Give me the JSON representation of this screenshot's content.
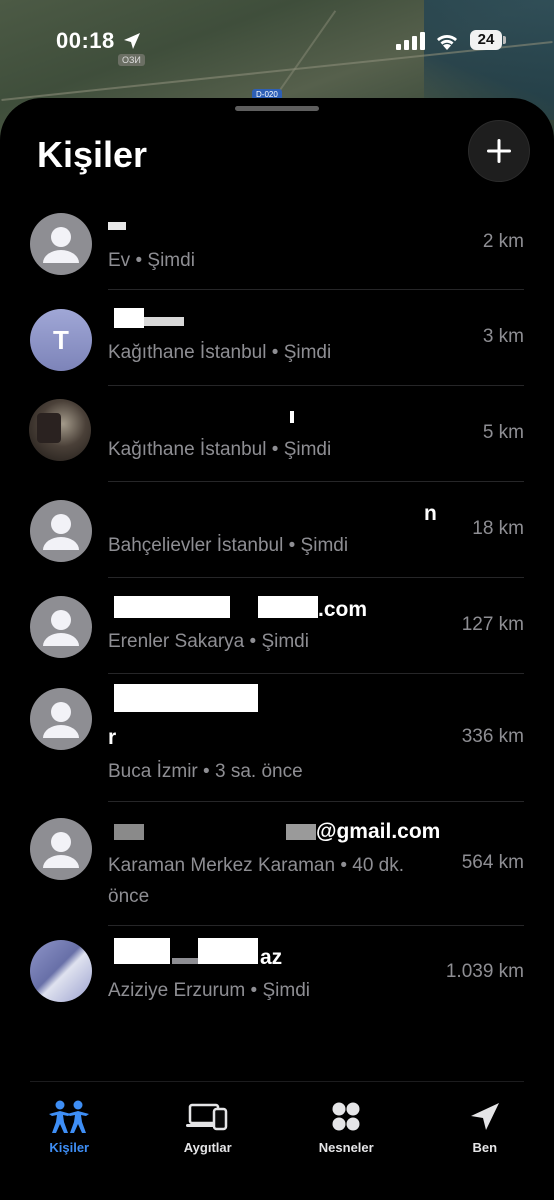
{
  "status_bar": {
    "time": "00:18",
    "battery": "24"
  },
  "map": {
    "labels": [
      "ОЗИ",
      "D-020"
    ]
  },
  "sheet": {
    "title": "Kişiler",
    "add_label": "+"
  },
  "people": [
    {
      "name": "",
      "initial": "",
      "location": "Ev",
      "time": "Şimdi",
      "distance": "2 km",
      "avatar": "generic"
    },
    {
      "name": "",
      "initial": "T",
      "location": "Kağıthane İstanbul",
      "time": "Şimdi",
      "distance": "3 km",
      "avatar": "initial"
    },
    {
      "name": "",
      "initial": "",
      "location": "Kağıthane İstanbul",
      "time": "Şimdi",
      "distance": "5 km",
      "avatar": "photo"
    },
    {
      "name": "n",
      "initial": "",
      "location": "Bahçelievler İstanbul",
      "time": "Şimdi",
      "distance": "18 km",
      "avatar": "generic"
    },
    {
      "name": ".com",
      "initial": "",
      "location": "Erenler Sakarya",
      "time": "Şimdi",
      "distance": "127 km",
      "avatar": "generic"
    },
    {
      "name": "r",
      "initial": "",
      "location": "Buca İzmir",
      "time": "3 sa. önce",
      "distance": "336 km",
      "avatar": "generic"
    },
    {
      "name": "@gmail.com",
      "initial": "",
      "location": "Karaman Merkez Karaman",
      "time": "40 dk. önce",
      "distance": "564 km",
      "avatar": "generic"
    },
    {
      "name": "az",
      "initial": "",
      "location": "Aziziye Erzurum",
      "time": "Şimdi",
      "distance": "1.039 km",
      "avatar": "abstract"
    }
  ],
  "tabs": [
    {
      "label": "Kişiler",
      "icon": "people-icon",
      "active": true
    },
    {
      "label": "Aygıtlar",
      "icon": "devices-icon",
      "active": false
    },
    {
      "label": "Nesneler",
      "icon": "items-icon",
      "active": false
    },
    {
      "label": "Ben",
      "icon": "location-arrow-icon",
      "active": false
    }
  ],
  "colors": {
    "accent": "#3e8ef5",
    "secondary_text": "#8e8e93",
    "sheet_bg": "#000000"
  }
}
